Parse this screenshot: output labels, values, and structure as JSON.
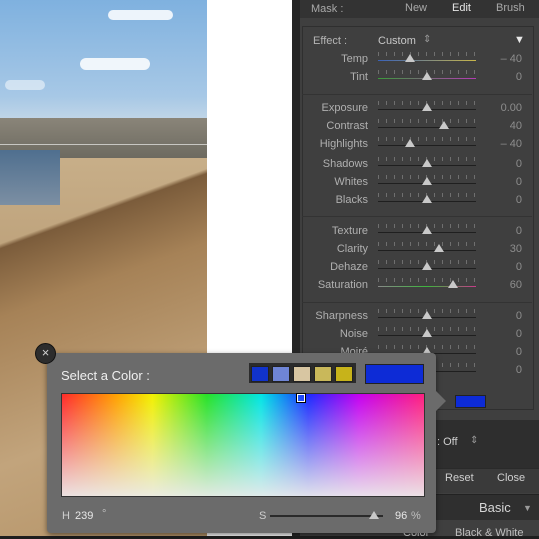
{
  "mask": {
    "label": "Mask :",
    "new_label": "New",
    "edit_label": "Edit",
    "brush_label": "Brush"
  },
  "effect": {
    "label": "Effect :",
    "value": "Custom",
    "stepper_glyph": "⇕",
    "collapse_glyph": "▼"
  },
  "sliders": [
    {
      "name": "temp",
      "label": "Temp",
      "value": "– 40",
      "level": 0.33
    },
    {
      "name": "tint",
      "label": "Tint",
      "value": "0",
      "level": 0.5
    },
    {
      "name": "exposure",
      "label": "Exposure",
      "value": "0.00",
      "level": 0.5
    },
    {
      "name": "contrast",
      "label": "Contrast",
      "value": "40",
      "level": 0.67
    },
    {
      "name": "highlights",
      "label": "Highlights",
      "value": "– 40",
      "level": 0.33
    },
    {
      "name": "shadows",
      "label": "Shadows",
      "value": "0",
      "level": 0.5
    },
    {
      "name": "whites",
      "label": "Whites",
      "value": "0",
      "level": 0.5
    },
    {
      "name": "blacks",
      "label": "Blacks",
      "value": "0",
      "level": 0.5
    },
    {
      "name": "texture",
      "label": "Texture",
      "value": "0",
      "level": 0.5
    },
    {
      "name": "clarity",
      "label": "Clarity",
      "value": "30",
      "level": 0.62
    },
    {
      "name": "dehaze",
      "label": "Dehaze",
      "value": "0",
      "level": 0.5
    },
    {
      "name": "saturation",
      "label": "Saturation",
      "value": "60",
      "level": 0.77
    },
    {
      "name": "sharpness",
      "label": "Sharpness",
      "value": "0",
      "level": 0.5
    },
    {
      "name": "noise",
      "label": "Noise",
      "value": "0",
      "level": 0.5
    },
    {
      "name": "moire",
      "label": "Moiré",
      "value": "0",
      "level": 0.5
    },
    {
      "name": "defringe",
      "label": "",
      "value": "0",
      "level": 0.5
    }
  ],
  "color_picker": {
    "title": "Select a Color :",
    "close_glyph": "×",
    "swatches": [
      "#1133cc",
      "#6f85d6",
      "#d8c6a2",
      "#c9b85a",
      "#c7b31a"
    ],
    "selected_color": "#0d2bd6",
    "hue_label": "H",
    "hue_value": "239",
    "hue_unit": "°",
    "sat_label": "S",
    "sat_value": "96",
    "sat_unit": "%",
    "saturation_level": 0.96
  },
  "panel_bottom": {
    "auto_mask": ": Off",
    "auto_mask_glyph": "⇕",
    "reset_label": "Reset",
    "close_label": "Close",
    "basic_label": "Basic",
    "basic_glyph": "▼",
    "treatment_partial": "Color",
    "bw_label": "Black & White"
  }
}
